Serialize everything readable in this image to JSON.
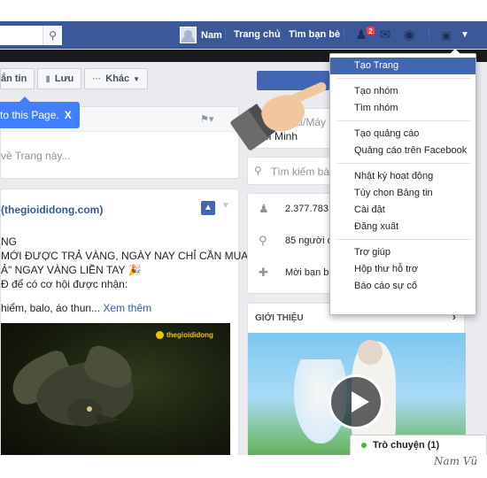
{
  "topbar": {
    "search_icon": "search-icon",
    "profile_name": "Nam",
    "nav_home": "Trang chủ",
    "nav_find_friends": "Tìm bạn bè",
    "friend_badge": "2",
    "icons": [
      "friends-icon",
      "messages-icon",
      "notifications-globe-icon",
      "privacy-lock-icon",
      "account-caret-icon"
    ],
    "color": "#3b5998"
  },
  "page_actions": {
    "message_label": "ắn tin",
    "save_label": "Lưu",
    "more_label": "Khác"
  },
  "tooltip": {
    "text": "to this Page.",
    "close": "X"
  },
  "composer": {
    "placeholder": "về Trang này..."
  },
  "post": {
    "title": "(thegioididong.com)",
    "lines": [
      "NG",
      "MỚI ĐƯỢC TRẢ VÀNG, NGÀY NAY CHỈ CẦN MUA",
      "Ả\" NGAY VÀNG LIỀN TAY 🎉",
      "Đ để có cơ hội được nhận:",
      "hiểm, balo, áo thun..."
    ],
    "see_more": "Xem thêm",
    "video_logo": "thegioididong"
  },
  "right_info": {
    "line1": "Điện thoại/Máy tí",
    "line2": "Chí Minh",
    "search_placeholder": "Tìm kiếm bài",
    "stats": [
      {
        "icon": "people-icon",
        "text": "2.377.783 n"
      },
      {
        "icon": "location-pin-icon",
        "text": "85 người đ"
      },
      {
        "icon": "invite-friend-icon",
        "text": "Mời bạn bè"
      }
    ],
    "about_title": "GIỚI THIỆU"
  },
  "dropdown": {
    "items": [
      {
        "label": "Tạo Trang",
        "active": true
      },
      {
        "label": "Tạo nhóm"
      },
      {
        "label": "Tìm nhóm"
      },
      {
        "label": "Tạo quảng cáo"
      },
      {
        "label": "Quảng cáo trên Facebook"
      },
      {
        "label": "Nhật ký hoạt động"
      },
      {
        "label": "Tùy chọn Bảng tin"
      },
      {
        "label": "Cài đặt"
      },
      {
        "label": "Đăng xuất"
      },
      {
        "label": "Trợ giúp"
      },
      {
        "label": "Hộp thư hỗ trợ"
      },
      {
        "label": "Báo cáo sự cố"
      }
    ],
    "active_color": "#4267b2"
  },
  "chat": {
    "label": "Trò chuyện (1)",
    "status_color": "#42b72a"
  },
  "signature": "Nam Vũ"
}
